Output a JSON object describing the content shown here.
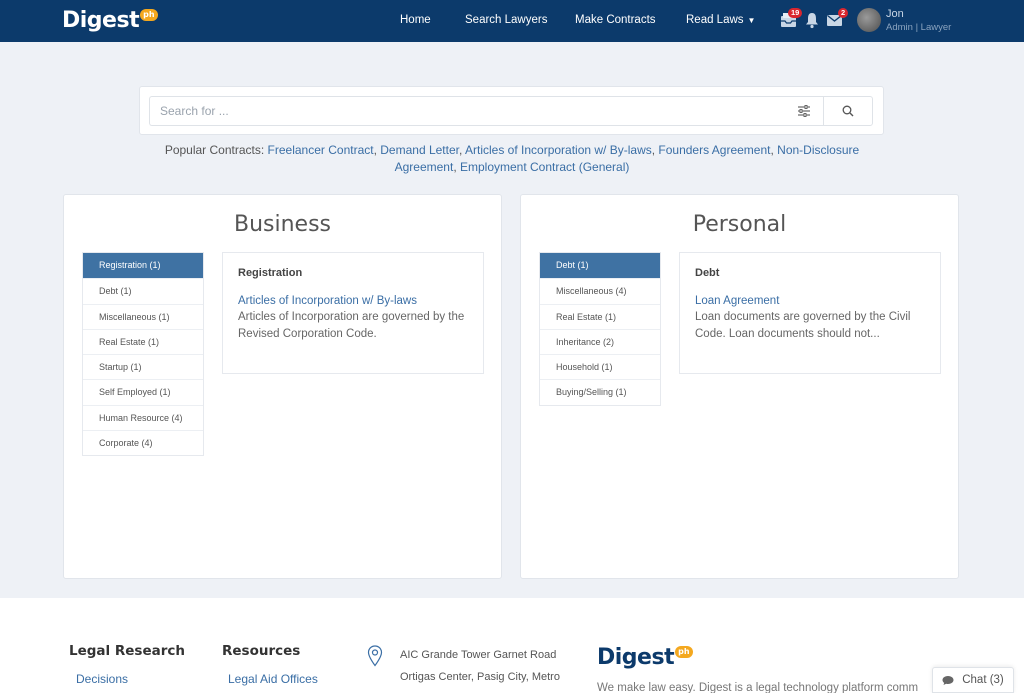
{
  "brand": {
    "name": "Digest",
    "suffix": "ph"
  },
  "nav": {
    "links": [
      "Home",
      "Search Lawyers",
      "Make Contracts",
      "Read Laws"
    ],
    "inbox_badge": "19",
    "mail_badge": "2",
    "user_name": "Jon",
    "user_role": "Admin | Lawyer"
  },
  "search": {
    "placeholder": "Search for ..."
  },
  "popular": {
    "label": "Popular Contracts:",
    "items": [
      "Freelancer Contract",
      "Demand Letter",
      "Articles of Incorporation w/ By-laws",
      "Founders Agreement",
      "Non-Disclosure Agreement",
      "Employment Contract (General)"
    ]
  },
  "business": {
    "title": "Business",
    "categories": [
      "Registration (1)",
      "Debt (1)",
      "Miscellaneous (1)",
      "Real Estate (1)",
      "Startup (1)",
      "Self Employed (1)",
      "Human Resource (4)",
      "Corporate (4)"
    ],
    "detail": {
      "heading": "Registration",
      "link": "Articles of Incorporation w/ By-laws",
      "desc": "Articles of Incorporation are governed by the Revised Corporation Code."
    }
  },
  "personal": {
    "title": "Personal",
    "categories": [
      "Debt (1)",
      "Miscellaneous (4)",
      "Real Estate (1)",
      "Inheritance (2)",
      "Household (1)",
      "Buying/Selling (1)"
    ],
    "detail": {
      "heading": "Debt",
      "link": "Loan Agreement",
      "desc": "Loan documents are governed by the Civil Code. Loan documents should not..."
    }
  },
  "footer": {
    "col1": {
      "heading": "Legal Research",
      "link": "Decisions"
    },
    "col2": {
      "heading": "Resources",
      "link": "Legal Aid Offices"
    },
    "address_line1": "AIC Grande Tower Garnet Road",
    "address_line2": "Ortigas Center, Pasig City, Metro",
    "tagline": "We make law easy. Digest is a legal technology platform comm"
  },
  "chat": {
    "label": "Chat (3)"
  },
  "colors": {
    "navbar": "#0c3a6b",
    "accent": "#3f72a3",
    "link": "#3a6ea5",
    "badge": "#d9262e",
    "brand_ph": "#f4a81f"
  }
}
